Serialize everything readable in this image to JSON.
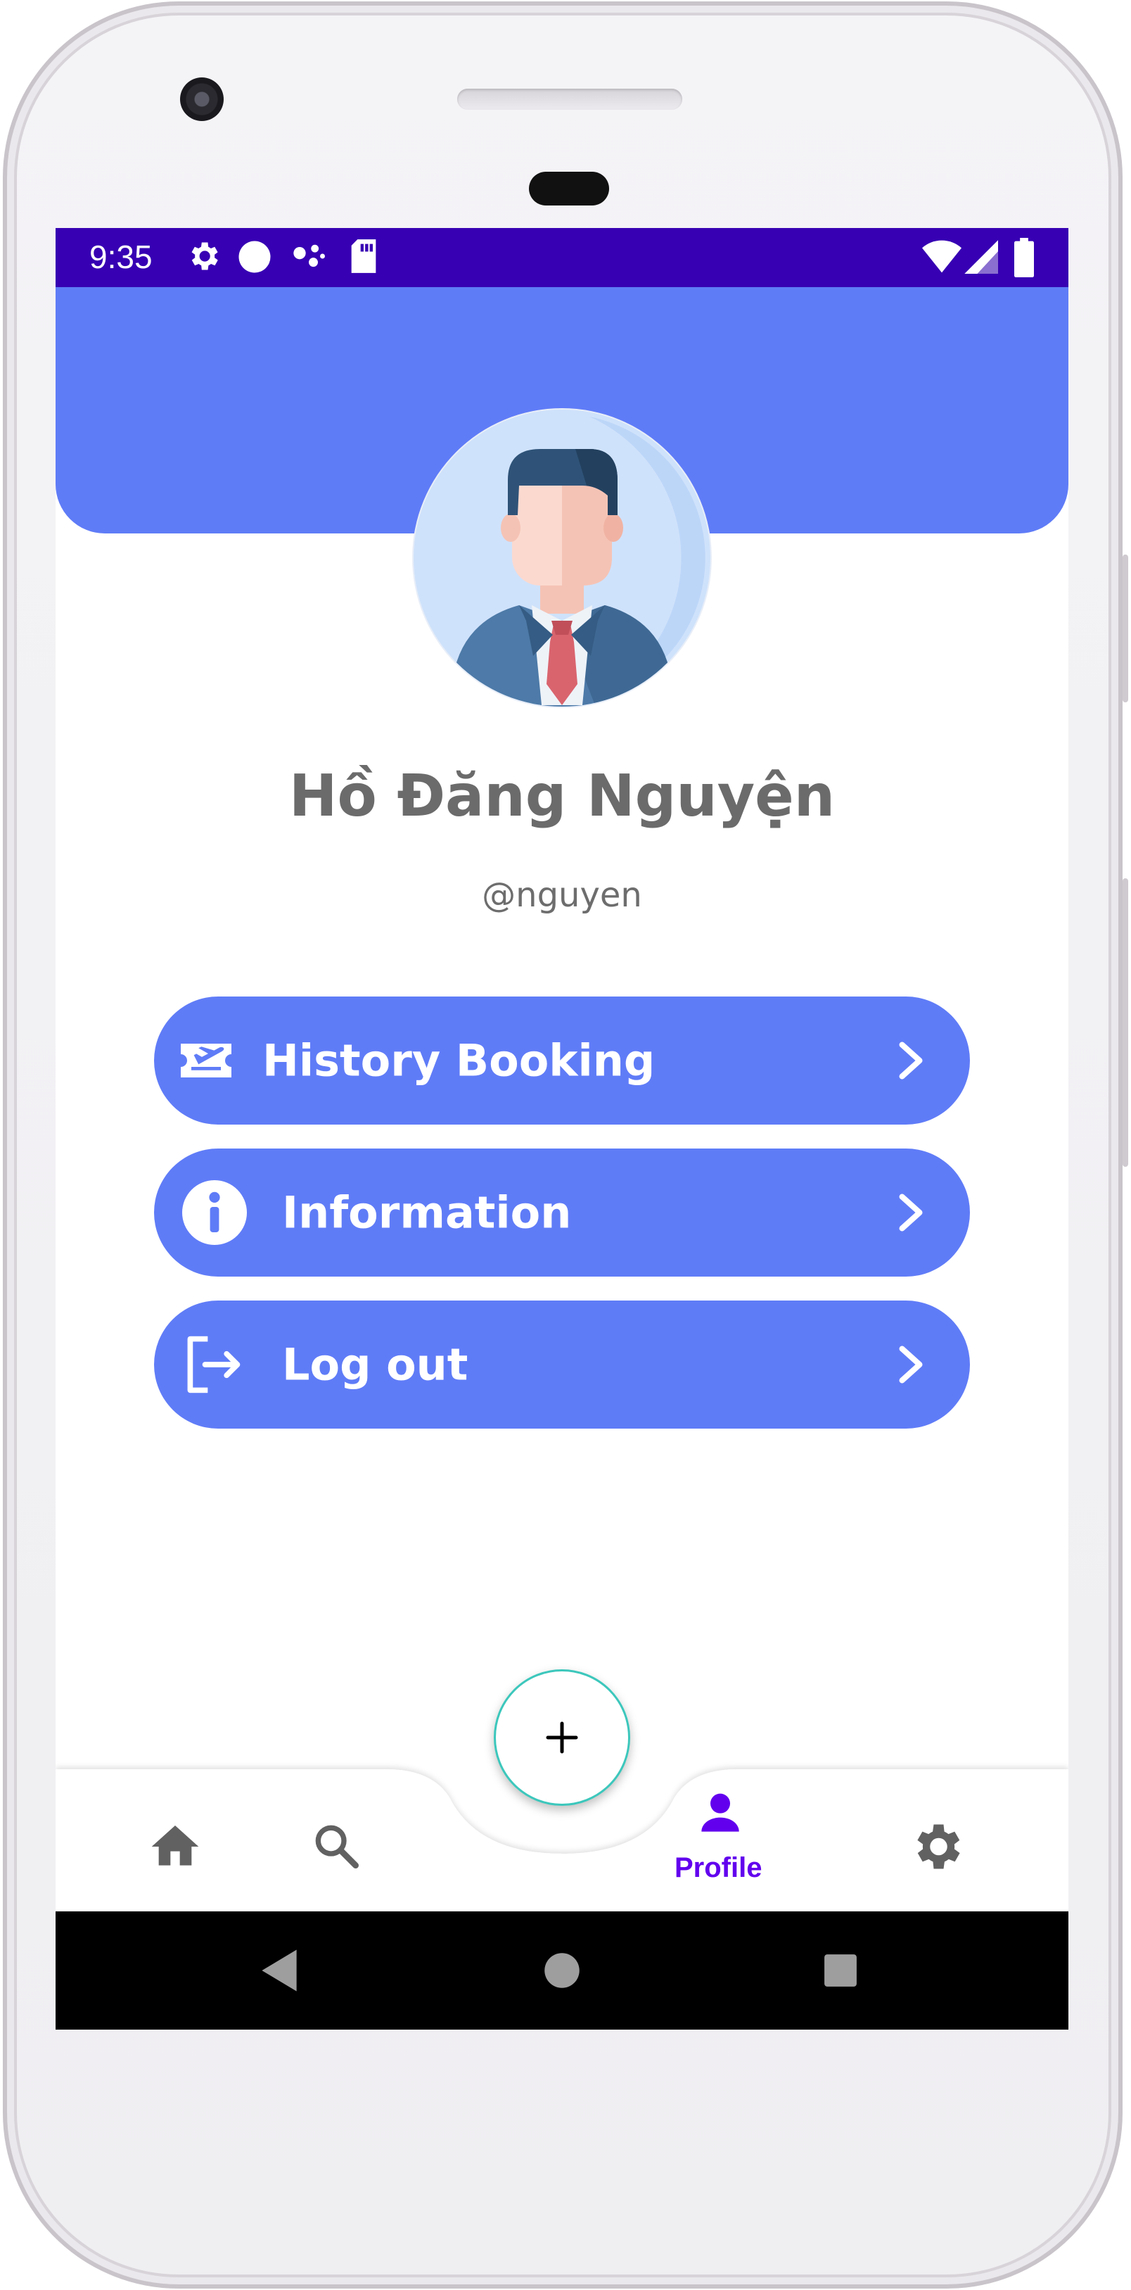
{
  "status_bar": {
    "time": "9:35",
    "icons": [
      "gear-icon",
      "circle-icon",
      "assistant-dots-icon",
      "sd-card-icon",
      "wifi-icon",
      "signal-icon",
      "battery-icon"
    ]
  },
  "profile": {
    "name": "Hồ Đăng Nguyện",
    "handle": "@nguyen"
  },
  "menu": {
    "history_booking": "History Booking",
    "information": "Information",
    "logout": "Log out"
  },
  "bottom_nav": {
    "profile_label": "Profile",
    "items": [
      "home-icon",
      "search-icon",
      "add-icon",
      "person-icon",
      "settings-icon"
    ]
  },
  "colors": {
    "status_bar": "#3700b3",
    "header": "#5f7cf7",
    "button": "#5f7cf7",
    "active_nav": "#6200ee",
    "inactive_nav": "#616161",
    "fab_border": "#3cc7bc"
  }
}
